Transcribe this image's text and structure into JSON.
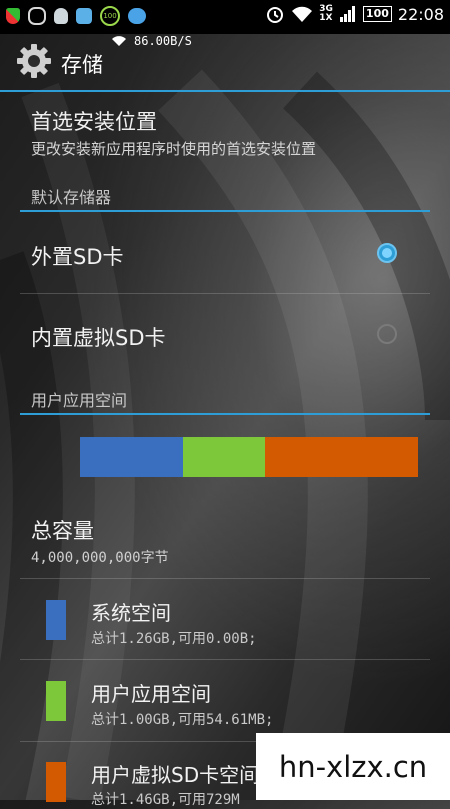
{
  "status_bar": {
    "network_speed": "86.00B/S",
    "network_type": "3G",
    "network_type2": "1X",
    "battery": "100",
    "time": "22:08",
    "icons": [
      "shield-icon",
      "wallet-icon",
      "qq-icon",
      "accelerator-icon",
      "badge-100-icon",
      "bird-icon",
      "alarm-icon",
      "wifi-icon",
      "signal-icon",
      "battery-icon"
    ]
  },
  "header": {
    "title": "存储",
    "icon": "gear-icon"
  },
  "install_location": {
    "title": "首选安装位置",
    "subtitle": "更改安装新应用程序时使用的首选安装位置"
  },
  "default_storage": {
    "section_label": "默认存储器",
    "options": [
      {
        "label": "外置SD卡",
        "selected": true
      },
      {
        "label": "内置虚拟SD卡",
        "selected": false
      }
    ]
  },
  "user_app_space": {
    "section_label": "用户应用空间",
    "bar": [
      {
        "name": "系统空间",
        "color": "#3a6fbf",
        "fraction": 0.305
      },
      {
        "name": "用户应用空间",
        "color": "#7cc83a",
        "fraction": 0.242
      },
      {
        "name": "用户虚拟SD卡空间",
        "color": "#d35a00",
        "fraction": 0.453
      }
    ]
  },
  "total": {
    "title": "总容量",
    "value": "4,000,000,000字节"
  },
  "legend": [
    {
      "title": "系统空间",
      "detail": "总计1.26GB,可用0.00B;",
      "color": "#3a6fbf"
    },
    {
      "title": "用户应用空间",
      "detail": "总计1.00GB,可用54.61MB;",
      "color": "#7cc83a"
    },
    {
      "title": "用户虚拟SD卡空间",
      "detail": "总计1.46GB,可用729M",
      "color": "#d35a00"
    }
  ],
  "watermark": "hn-xlzx.cn"
}
